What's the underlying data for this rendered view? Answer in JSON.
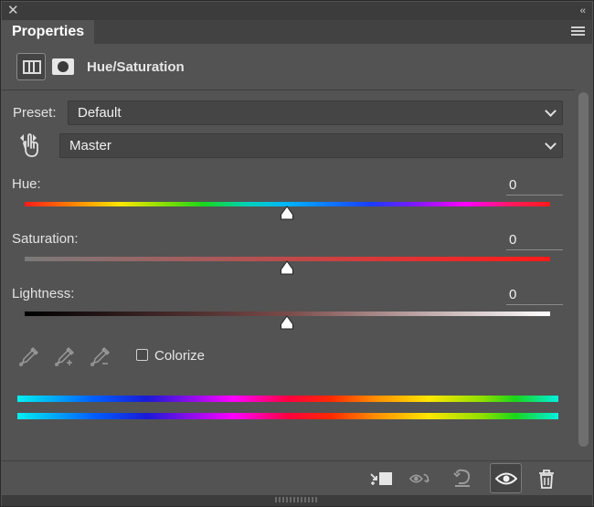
{
  "window": {
    "close_glyph": "✕",
    "collapse_glyph": "‹‹"
  },
  "tabs": [
    {
      "label": "Properties",
      "active": true
    }
  ],
  "adjustment": {
    "title": "Hue/Saturation",
    "icons": [
      "adjustment-layer-icon",
      "layer-mask-icon"
    ]
  },
  "preset": {
    "label": "Preset:",
    "selected": "Default"
  },
  "channel": {
    "selected": "Master",
    "tool_icon": "on-image-adjustment-hand-icon"
  },
  "sliders": {
    "hue": {
      "label": "Hue:",
      "value": "0",
      "handle_fraction": 0.5,
      "range": [
        -180,
        180
      ]
    },
    "saturation": {
      "label": "Saturation:",
      "value": "0",
      "handle_fraction": 0.5,
      "range": [
        -100,
        100
      ]
    },
    "lightness": {
      "label": "Lightness:",
      "value": "0",
      "handle_fraction": 0.5,
      "range": [
        -100,
        100
      ]
    }
  },
  "tools": {
    "eyedroppers": [
      "eyedropper-icon",
      "eyedropper-add-icon",
      "eyedropper-subtract-icon"
    ],
    "colorize_label": "Colorize",
    "colorize_checked": false
  },
  "bottom_buttons": [
    "clip-to-layer-icon",
    "view-previous-state-icon",
    "reset-icon",
    "toggle-visibility-icon",
    "delete-icon"
  ],
  "colors": {
    "panel_bg": "#535353",
    "titlebar_bg": "#3c3c3c",
    "field_bg": "#454545",
    "text": "#e3e3e3"
  }
}
